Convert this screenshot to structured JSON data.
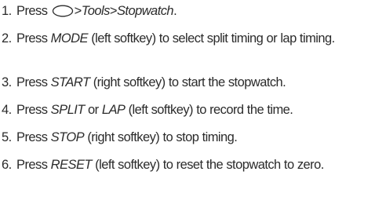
{
  "steps": [
    {
      "number": "1.",
      "parts": [
        "Press ",
        ">",
        "Tools",
        ">",
        "Stopwatch",
        "."
      ],
      "icon": "menu-key-oval-icon"
    },
    {
      "number": "2.",
      "parts": [
        "Press ",
        "MODE",
        " (left softkey) to select split timing or lap timing."
      ]
    },
    {
      "number": "3.",
      "parts": [
        "Press ",
        "START",
        " (right softkey) to start the stopwatch."
      ]
    },
    {
      "number": "4.",
      "parts": [
        "Press ",
        "SPLIT",
        " or ",
        "LAP",
        " (left softkey) to record the time."
      ]
    },
    {
      "number": "5.",
      "parts": [
        "Press ",
        "STOP",
        " (right softkey) to stop timing."
      ]
    },
    {
      "number": "6.",
      "parts": [
        "Press ",
        "RESET",
        " (left softkey) to reset the stopwatch to zero."
      ]
    }
  ]
}
